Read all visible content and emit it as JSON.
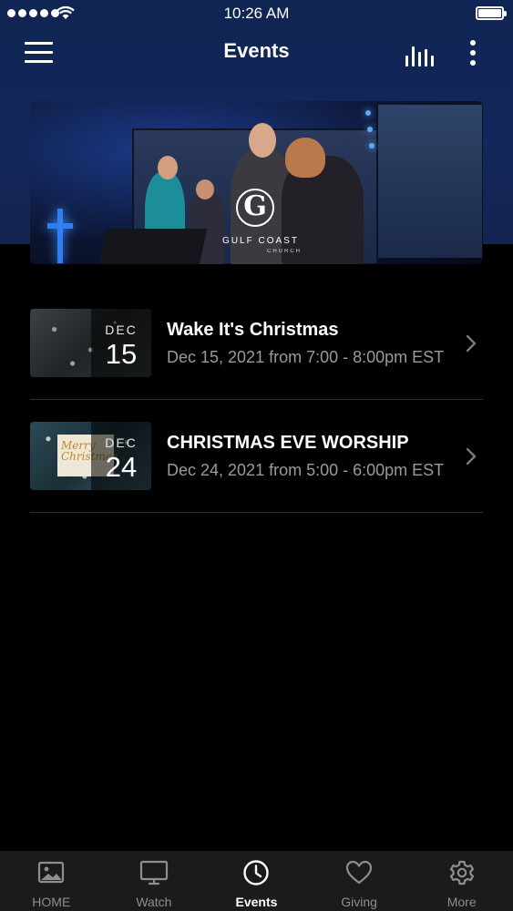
{
  "status_bar": {
    "time": "10:26 AM"
  },
  "header": {
    "title": "Events"
  },
  "banner": {
    "logo_text": "GULF COAST",
    "logo_sub": "CHURCH"
  },
  "events": [
    {
      "title": "Wake It's Christmas",
      "month": "DEC",
      "day": "15",
      "subtitle": "Dec 15, 2021 from 7:00 - 8:00pm EST"
    },
    {
      "title": "CHRISTMAS EVE WORSHIP",
      "month": "DEC",
      "day": "24",
      "subtitle": "Dec 24, 2021 from 5:00 - 6:00pm EST",
      "thumb_card_text": "Merry Christmas"
    }
  ],
  "tabs": [
    {
      "label": "HOME",
      "icon": "image-icon",
      "active": false
    },
    {
      "label": "Watch",
      "icon": "tv-icon",
      "active": false
    },
    {
      "label": "Events",
      "icon": "clock-icon",
      "active": true
    },
    {
      "label": "Giving",
      "icon": "heart-icon",
      "active": false
    },
    {
      "label": "More",
      "icon": "gear-icon",
      "active": false
    }
  ],
  "colors": {
    "header_bg": "#13275a",
    "page_bg": "#000000",
    "tab_bar_bg": "#1b1b1b",
    "tab_inactive": "#8e8e8e",
    "tab_active": "#ffffff",
    "subtitle": "#9a9a9a"
  }
}
